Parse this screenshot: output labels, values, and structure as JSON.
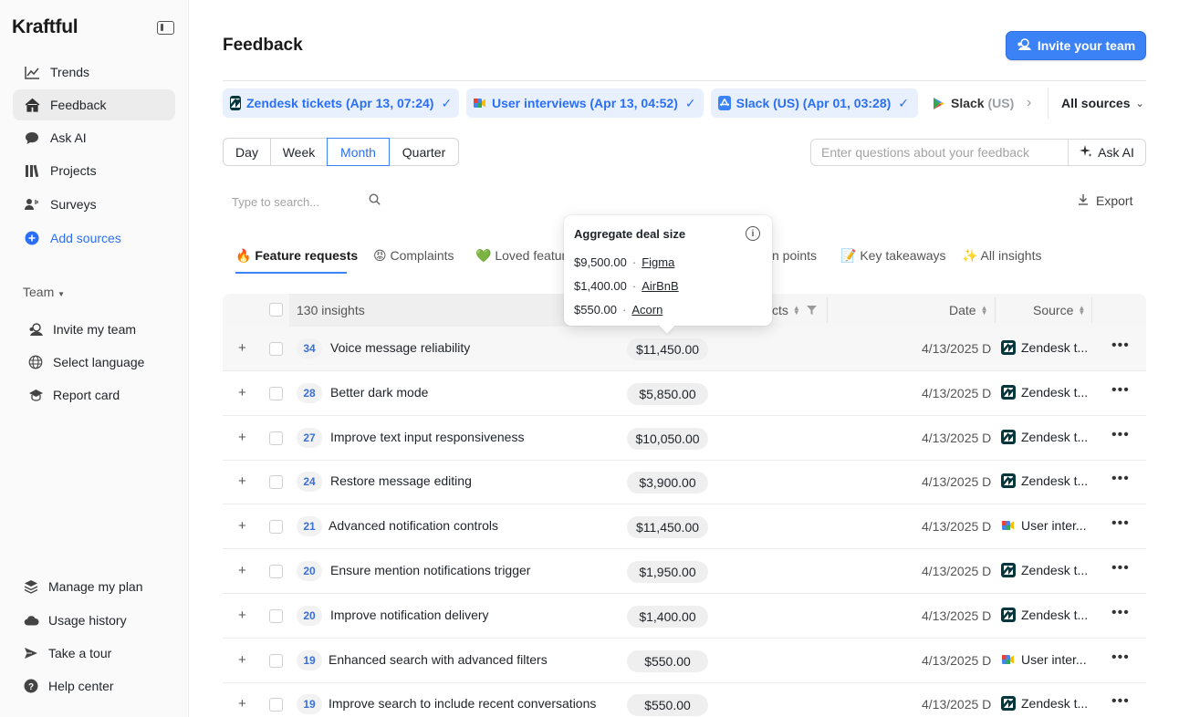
{
  "sidebar": {
    "logo": "Kraftful",
    "nav": [
      {
        "label": "Trends",
        "icon": "trend-chart-icon"
      },
      {
        "label": "Feedback",
        "icon": "home-icon"
      },
      {
        "label": "Ask AI",
        "icon": "chat-bubble-icon"
      },
      {
        "label": "Projects",
        "icon": "projects-icon"
      },
      {
        "label": "Surveys",
        "icon": "survey-icon"
      },
      {
        "label": "Add sources",
        "icon": "plus-circle-icon"
      }
    ],
    "team_label": "Team",
    "team_items": [
      {
        "label": "Invite my team"
      },
      {
        "label": "Select language"
      },
      {
        "label": "Report card"
      }
    ],
    "bottom_items": [
      {
        "label": "Manage my plan"
      },
      {
        "label": "Usage history"
      },
      {
        "label": "Take a tour"
      },
      {
        "label": "Help center"
      }
    ]
  },
  "header": {
    "title": "Feedback",
    "invite_label": "Invite your team"
  },
  "sources": [
    {
      "label": "Zendesk tickets",
      "time": "(Apr 13, 07:24)"
    },
    {
      "label": "User interviews",
      "time": "(Apr 13, 04:52)"
    },
    {
      "label": "Slack (US)",
      "time": "(Apr 01, 03:28)"
    },
    {
      "label": "Slack",
      "faded": "(US)"
    }
  ],
  "all_sources_label": "All sources",
  "periods": [
    "Day",
    "Week",
    "Month",
    "Quarter"
  ],
  "ask": {
    "placeholder": "Enter questions about your feedback",
    "button": "Ask AI"
  },
  "search": {
    "placeholder": "Type to search..."
  },
  "export_label": "Export",
  "tabs": [
    {
      "label": "🔥 Feature requests"
    },
    {
      "label": "😡 Complaints"
    },
    {
      "label": "💚 Loved feature"
    },
    {
      "label": "n points"
    },
    {
      "label": "📝 Key takeaways"
    },
    {
      "label": "✨ All insights"
    }
  ],
  "table": {
    "insights_count": "130 insights",
    "col_impacts": "cts",
    "col_date": "Date",
    "col_source": "Source",
    "rows": [
      {
        "count": "34",
        "name": "Voice message reliability",
        "deal": "$11,450.00",
        "date": "4/13/2025 D",
        "source": "Zendesk t...",
        "src": "zendesk"
      },
      {
        "count": "28",
        "name": "Better dark mode",
        "deal": "$5,850.00",
        "date": "4/13/2025 D",
        "source": "Zendesk t...",
        "src": "zendesk"
      },
      {
        "count": "27",
        "name": "Improve text input responsiveness",
        "deal": "$10,050.00",
        "date": "4/13/2025 D",
        "source": "Zendesk t...",
        "src": "zendesk"
      },
      {
        "count": "24",
        "name": "Restore message editing",
        "deal": "$3,900.00",
        "date": "4/13/2025 D",
        "source": "Zendesk t...",
        "src": "zendesk"
      },
      {
        "count": "21",
        "name": "Advanced notification controls",
        "deal": "$11,450.00",
        "date": "4/13/2025 D",
        "source": "User inter...",
        "src": "interview"
      },
      {
        "count": "20",
        "name": "Ensure mention notifications trigger",
        "deal": "$1,950.00",
        "date": "4/13/2025 D",
        "source": "Zendesk t...",
        "src": "zendesk"
      },
      {
        "count": "20",
        "name": "Improve notification delivery",
        "deal": "$1,400.00",
        "date": "4/13/2025 D",
        "source": "Zendesk t...",
        "src": "zendesk"
      },
      {
        "count": "19",
        "name": "Enhanced search with advanced filters",
        "deal": "$550.00",
        "date": "4/13/2025 D",
        "source": "User inter...",
        "src": "interview"
      },
      {
        "count": "19",
        "name": "Improve search to include recent conversations",
        "deal": "$550.00",
        "date": "4/13/2025 D",
        "source": "Zendesk t...",
        "src": "zendesk"
      }
    ]
  },
  "tooltip": {
    "title": "Aggregate deal size",
    "lines": [
      {
        "amount": "$9,500.00",
        "sep": "·",
        "company": "Figma"
      },
      {
        "amount": "$1,400.00",
        "sep": "·",
        "company": "AirBnB"
      },
      {
        "amount": "$550.00",
        "sep": "·",
        "company": "Acorn"
      }
    ]
  },
  "colors": {
    "accent": "#3b82f6",
    "chip_bg": "#e8f0fd",
    "zendesk": "#03363d"
  }
}
